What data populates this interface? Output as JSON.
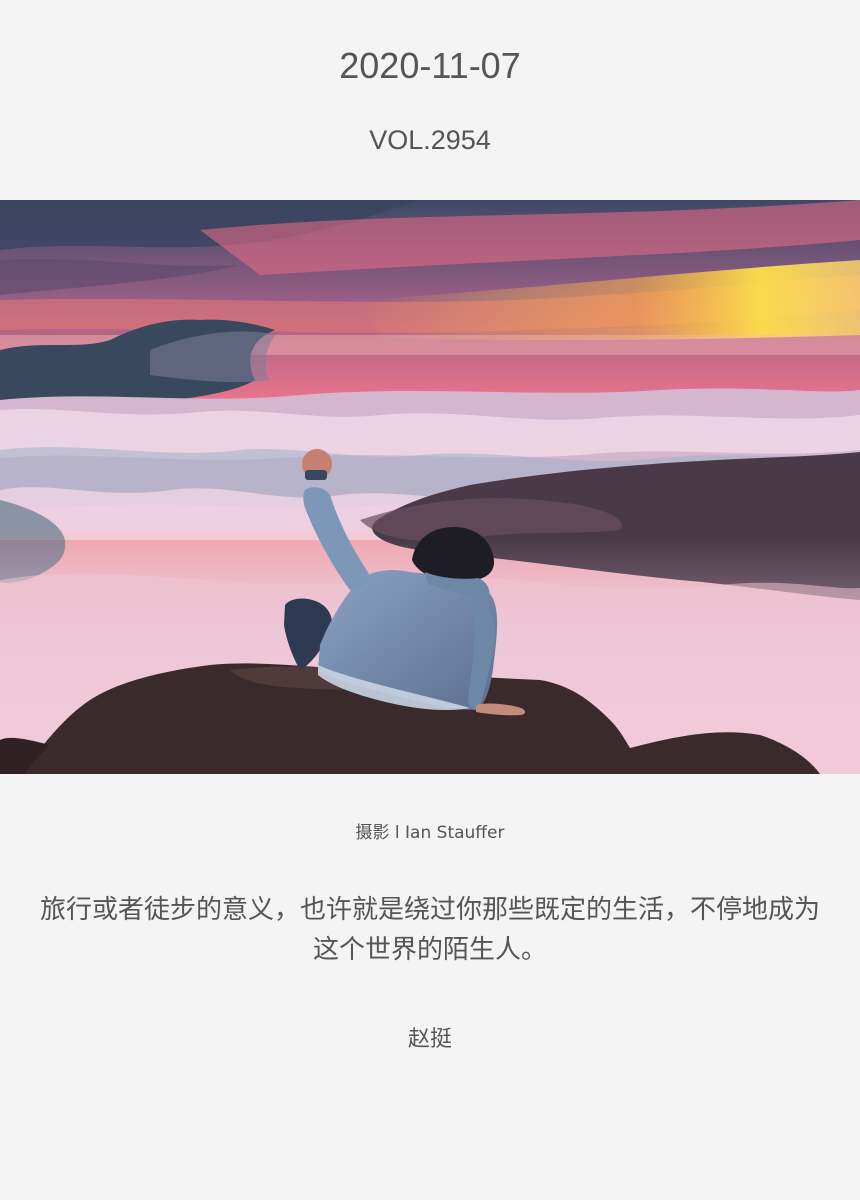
{
  "header": {
    "date": "2020-11-07",
    "volume": "VOL.2954"
  },
  "photo": {
    "subject": "Person with raised fist sitting on a rock above a sea of clouds at sunset",
    "colors": {
      "sky_top": "#3f4866",
      "sky_pink": "#e9748b",
      "sky_glow": "#ffd14a",
      "clouds": "#e7c0d3",
      "rock": "#3b2a2c"
    }
  },
  "credit": "摄影 l Ian Stauffer",
  "quote": "旅行或者徒步的意义，也许就是绕过你那些既定的生活，不停地成为这个世界的陌生人。",
  "author": "赵挺"
}
